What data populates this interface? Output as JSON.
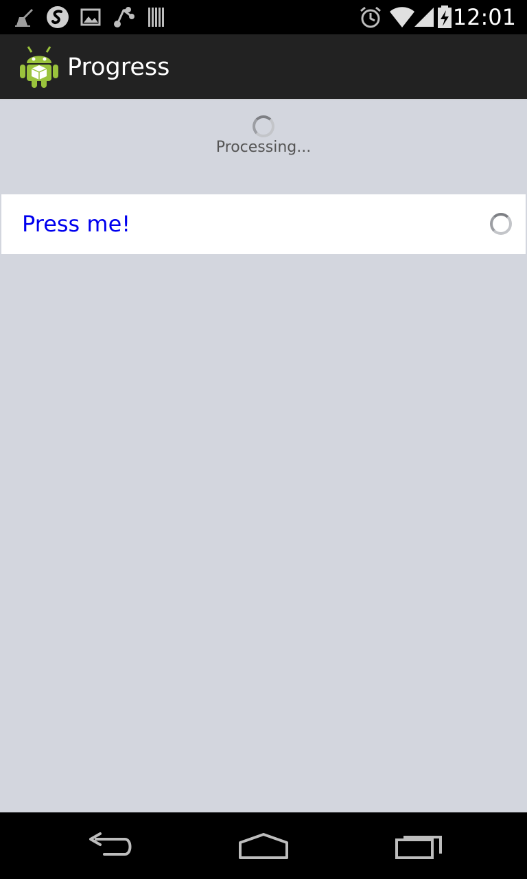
{
  "status_bar": {
    "time": "12:01",
    "left_icons": [
      "cleaner-icon",
      "swiftkey-icon",
      "image-icon",
      "share-icon",
      "barcode-icon"
    ],
    "right_icons": [
      "alarm-icon",
      "wifi-icon",
      "signal-icon",
      "battery-charging-icon"
    ]
  },
  "action_bar": {
    "title": "Progress",
    "icon": "android-app-icon"
  },
  "content": {
    "processing_text": "Processing...",
    "row_label": "Press me!",
    "row_label_color": "#0000ee"
  },
  "nav_bar": {
    "buttons": [
      "back-icon",
      "home-icon",
      "recents-icon"
    ]
  }
}
